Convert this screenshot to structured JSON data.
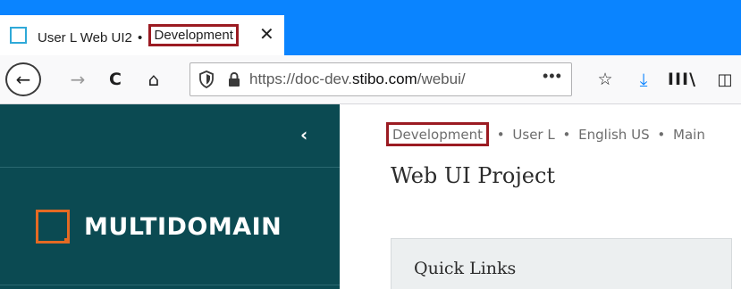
{
  "browser": {
    "tab": {
      "title_prefix": "User L Web UI2",
      "separator": "•",
      "environment": "Development",
      "close_glyph": "✕"
    },
    "nav": {
      "back_glyph": "←",
      "forward_glyph": "→",
      "reload_glyph": "C",
      "home_glyph": "⌂",
      "url_prefix": "https://doc-dev.",
      "url_domain": "stibo.com",
      "url_suffix": "/webui/",
      "overflow_glyph": "•••",
      "bookmark_glyph": "☆",
      "download_glyph": "⤓",
      "library_glyph": "III\\",
      "sidebar_glyph": "◫"
    },
    "accent_color": "#0a84ff",
    "highlight_color": "#9b1b22"
  },
  "app": {
    "sidebar": {
      "collapse_glyph": "‹",
      "logo_text": "MULTIDOMAIN",
      "background_color": "#0b4a52",
      "logo_color": "#e46a23"
    },
    "breadcrumb": {
      "environment": "Development",
      "separator": "•",
      "user": "User L",
      "language": "English US",
      "workspace": "Main"
    },
    "page_title": "Web UI Project",
    "quick_links": {
      "title": "Quick Links"
    }
  },
  "icons": [
    "tab-favicon-icon",
    "close-icon",
    "back-arrow-icon",
    "forward-arrow-icon",
    "reload-icon",
    "home-icon",
    "shield-icon",
    "lock-icon",
    "more-icon",
    "bookmark-star-icon",
    "download-icon",
    "library-icon",
    "sidebar-icon",
    "chevron-left-icon",
    "multidomain-logo-icon"
  ]
}
